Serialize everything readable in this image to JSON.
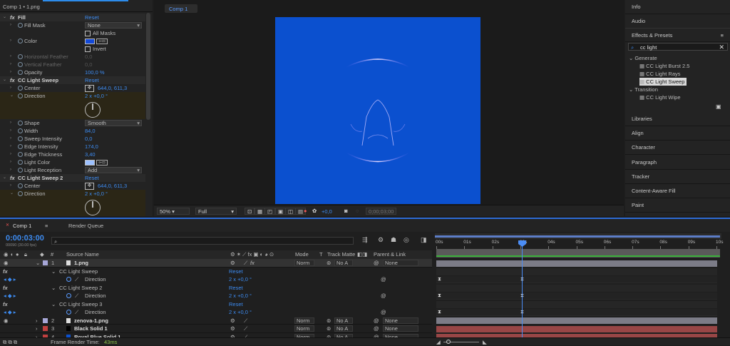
{
  "effect_controls": {
    "tab_label": "Comp 1 • 1.png",
    "rows": [
      {
        "kind": "fx",
        "label": "Fill",
        "value": "Reset"
      },
      {
        "kind": "param",
        "label": "Fill Mask",
        "dropdown": "None"
      },
      {
        "kind": "check",
        "label": "All Masks"
      },
      {
        "kind": "color",
        "label": "Color",
        "color": "#1349d8"
      },
      {
        "kind": "check",
        "label": "Invert"
      },
      {
        "kind": "param",
        "label": "Horizontal Feather",
        "value": "0,0",
        "disabled": true
      },
      {
        "kind": "param",
        "label": "Vertical Feather",
        "value": "0,0",
        "disabled": true
      },
      {
        "kind": "param",
        "label": "Opacity",
        "value": "100,0 %"
      },
      {
        "kind": "fx",
        "label": "CC Light Sweep",
        "value": "Reset"
      },
      {
        "kind": "point",
        "label": "Center",
        "value": "644,0, 611,3"
      },
      {
        "kind": "param",
        "label": "Direction",
        "value": "2 x +0,0 °",
        "dial": true
      },
      {
        "kind": "param",
        "label": "Shape",
        "dropdown": "Smooth"
      },
      {
        "kind": "param",
        "label": "Width",
        "value": "84,0"
      },
      {
        "kind": "param",
        "label": "Sweep Intensity",
        "value": "0,0"
      },
      {
        "kind": "param",
        "label": "Edge Intensity",
        "value": "174,0"
      },
      {
        "kind": "param",
        "label": "Edge Thickness",
        "value": "3,40"
      },
      {
        "kind": "color",
        "label": "Light Color",
        "color": "#9cc0ff"
      },
      {
        "kind": "param",
        "label": "Light Reception",
        "dropdown": "Add"
      },
      {
        "kind": "fx",
        "label": "CC Light Sweep 2",
        "value": "Reset"
      },
      {
        "kind": "point",
        "label": "Center",
        "value": "644,0, 611,3"
      },
      {
        "kind": "param",
        "label": "Direction",
        "value": "2 x +0,0 °",
        "dial": true
      }
    ]
  },
  "viewer": {
    "tab_label": "Comp 1",
    "zoom": "50%",
    "resolution": "Full",
    "exposure": "+0,0",
    "timecode": "0;00;03;00"
  },
  "right_panel": {
    "info": "Info",
    "audio": "Audio",
    "effects_presets": "Effects & Presets",
    "search_value": "cc light",
    "tree": [
      {
        "label": "Generate",
        "level": 0
      },
      {
        "label": "CC Light Burst 2.5",
        "level": 1
      },
      {
        "label": "CC Light Rays",
        "level": 1
      },
      {
        "label": "CC Light Sweep",
        "level": 1,
        "selected": true
      },
      {
        "label": "Transition",
        "level": 0
      },
      {
        "label": "CC Light Wipe",
        "level": 1
      }
    ],
    "panels": [
      "Libraries",
      "Align",
      "Character",
      "Paragraph",
      "Tracker",
      "Content-Aware Fill",
      "Paint"
    ]
  },
  "timeline": {
    "comp_tab": "Comp 1",
    "render_queue": "Render Queue",
    "timecode": "0:00:03:00",
    "fps": "00090 (30.00 fps)",
    "headers": {
      "num": "#",
      "source": "Source Name",
      "mode": "Mode",
      "t": "T",
      "track_matte": "Track Matte",
      "parent": "Parent & Link"
    },
    "ruler": [
      "00s",
      "01s",
      "02s",
      "03s",
      "04s",
      "05s",
      "06s",
      "07s",
      "08s",
      "09s",
      "10s"
    ],
    "layers": [
      {
        "num": "1",
        "name": "1.png",
        "color": "#a7a7d8",
        "mode": "Norm",
        "matte": "No A",
        "parent": "None",
        "bar": "#7c7c87"
      },
      {
        "num": "2",
        "name": "zenova-1.png",
        "color": "#a7a7d8",
        "mode": "Norm",
        "matte": "No A",
        "parent": "None",
        "bar": "#7c7c87"
      },
      {
        "num": "3",
        "name": "Black Solid 1",
        "color": "#c04040",
        "mode": "Norm",
        "matte": "No A",
        "parent": "None",
        "bar": "#984646"
      },
      {
        "num": "4",
        "name": "Royal Blue Solid 1",
        "color": "#c04040",
        "mode": "Norm",
        "matte": "No A",
        "parent": "None",
        "bar": "#984646"
      }
    ],
    "effects": [
      {
        "name": "CC Light Sweep",
        "reset": "Reset",
        "param": "Direction",
        "value": "2 x +0,0 °"
      },
      {
        "name": "CC Light Sweep 2",
        "reset": "Reset",
        "param": "Direction",
        "value": "2 x +0,0 °"
      },
      {
        "name": "CC Light Sweep 3",
        "reset": "Reset",
        "param": "Direction",
        "value": "2 x +0,0 °"
      }
    ],
    "footer_label": "Frame Render Time:",
    "footer_value": "43ms"
  }
}
